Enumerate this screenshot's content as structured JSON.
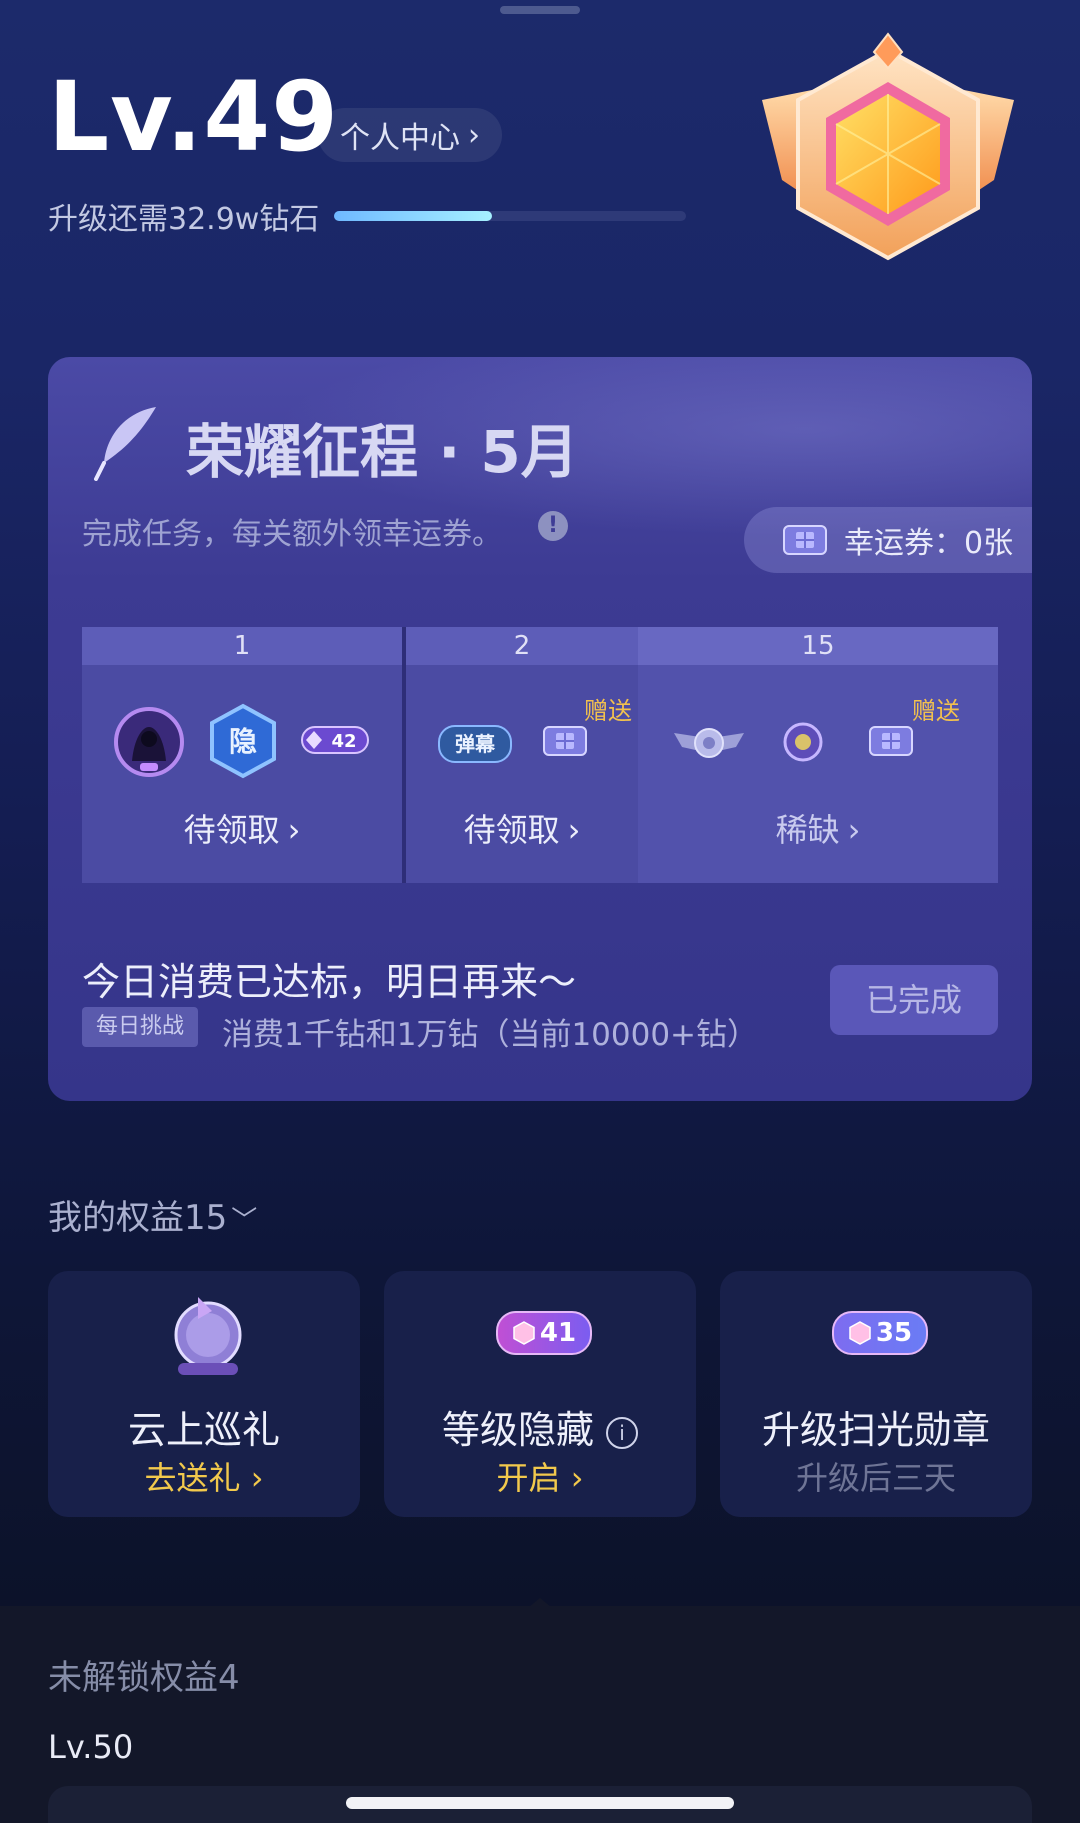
{
  "header": {
    "level": "Lv.49",
    "profile_link": "个人中心",
    "upgrade_text": "升级还需32.9w钻石",
    "progress": 0.45
  },
  "honor": {
    "title": "荣耀征程 · 5月",
    "subtitle": "完成任务，每关额外领幸运券。",
    "ticket_label": "幸运券：0张",
    "stages": [
      {
        "num": "1",
        "reward_badge": "42",
        "status": "待领取"
      },
      {
        "num": "2",
        "reward_tag": "弹幕",
        "gift": "赠送",
        "status": "待领取"
      },
      {
        "num": "15",
        "gift": "赠送",
        "status": "稀缺"
      }
    ],
    "daily": {
      "title": "今日消费已达标，明日再来～",
      "tag": "每日挑战",
      "desc": "消费1千钻和1万钻（当前10000+钻）",
      "button": "已完成"
    }
  },
  "rights": {
    "title": "我的权益15",
    "items": [
      {
        "name": "云上巡礼",
        "action": "去送礼"
      },
      {
        "name": "等级隐藏",
        "level": "41",
        "action": "开启"
      },
      {
        "name": "升级扫光勋章",
        "level": "35",
        "action": "升级后三天"
      }
    ]
  },
  "locked": {
    "title": "未解锁权益4",
    "level": "Lv.50"
  },
  "colors": {
    "accent_gold": "#f2c94c",
    "card_purple": "#3d3b93",
    "progress": "#a6f0ff"
  }
}
